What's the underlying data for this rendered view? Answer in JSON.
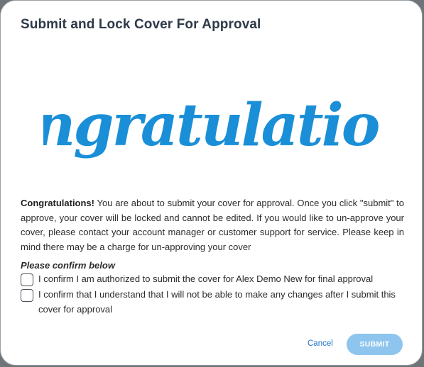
{
  "dialog": {
    "title": "Submit and Lock Cover For Approval",
    "banner_text": "Congratulations!",
    "message_lead": "Congratulations!",
    "message_body": " You are about to submit your cover for approval. Once you click \"submit\" to approve, your cover will be locked and cannot be edited. If you would like to un-approve your cover, please contact your account manager or customer support for service. Please keep in mind there may be a charge for un-approving your cover",
    "confirm_heading": "Please confirm below",
    "checkboxes": [
      {
        "label": "I confirm I am authorized to submit the cover for Alex Demo New for final approval",
        "checked": false
      },
      {
        "label": "I confirm that I understand that I will not be able to make any changes after I submit this cover for approval",
        "checked": false
      }
    ],
    "cancel_label": "Cancel",
    "submit_label": "SUBMIT"
  },
  "colors": {
    "title": "#2e3a48",
    "banner": "#1a8fd8",
    "link": "#1f74c8",
    "submit_bg": "#8ec5ef"
  }
}
